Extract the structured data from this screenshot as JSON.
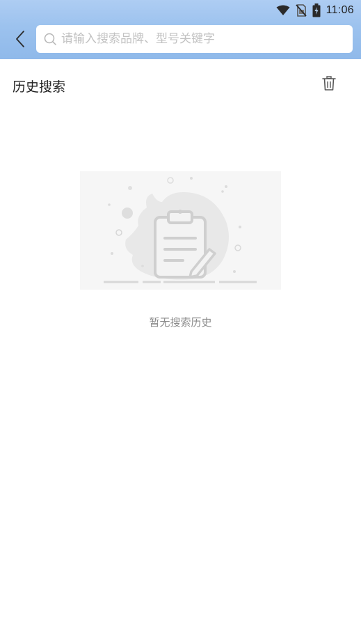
{
  "status_bar": {
    "time": "11:06",
    "icons": [
      "wifi-icon",
      "no-sim-icon",
      "battery-charging-icon"
    ]
  },
  "nav": {
    "back_icon": "chevron-left-icon",
    "search": {
      "placeholder": "请输入搜索品牌、型号关键字",
      "value": "",
      "icon": "search-icon"
    }
  },
  "history": {
    "title": "历史搜索",
    "clear_icon": "trash-icon"
  },
  "empty_state": {
    "illustration_icon": "clipboard-edit-icon",
    "message": "暂无搜索历史"
  },
  "colors": {
    "header_gradient_top": "#aecdf3",
    "header_gradient_bottom": "#8fb9ea",
    "placeholder": "#c2c2c2",
    "empty_text": "#8a8a8a"
  }
}
